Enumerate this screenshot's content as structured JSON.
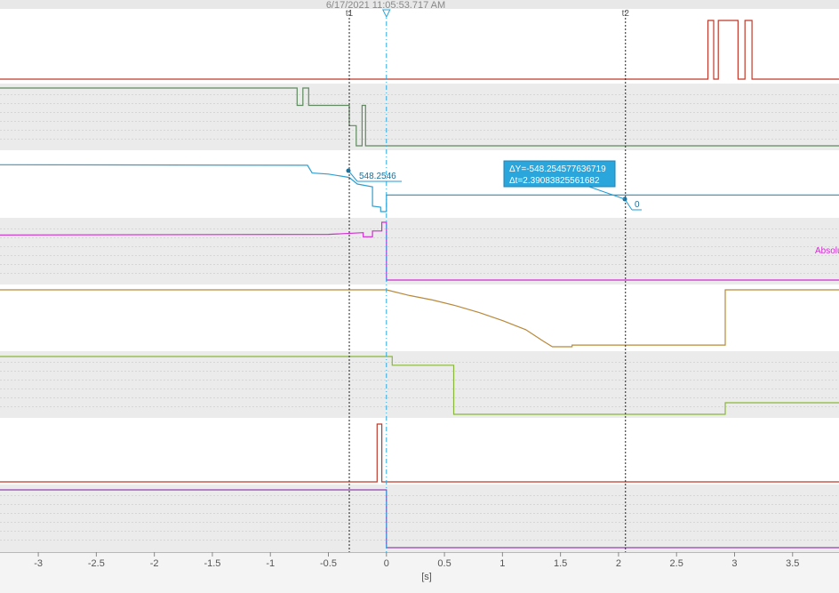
{
  "header": {
    "timestamp": "6/17/2021  11:05:53.717 AM"
  },
  "cursors": [
    {
      "label": "t1",
      "time": -0.32,
      "style": "black-dashed"
    },
    {
      "label": "",
      "time": 0.0,
      "style": "cyan-dashdot",
      "marker": "triangle-down"
    },
    {
      "label": "t2",
      "time": 2.06,
      "style": "black-dashed"
    }
  ],
  "measurement": {
    "delta_y_label": "ΔY=-548.254577636719",
    "delta_t_label": "Δt=2.39083825561682",
    "value_t1_label": "548.2546",
    "value_t2_label": "0",
    "accent": "#1e9bd7"
  },
  "signal_label": {
    "text": "Absolu",
    "color": "#d22bd2"
  },
  "x_axis": {
    "unit_label": "[s]",
    "range": [
      -3.33,
      3.9
    ],
    "ticks": [
      "-3",
      "-2.5",
      "-2",
      "-1.5",
      "-1",
      "-0.5",
      "0",
      "0.5",
      "1",
      "1.5",
      "2",
      "2.5",
      "3",
      "3.5"
    ]
  },
  "chart_data": {
    "type": "line",
    "title": "",
    "xlabel": "[s]",
    "xlim": [
      -3.33,
      3.9
    ],
    "series": [
      {
        "color": "#c0392b",
        "points": [
          [
            -3.33,
            0
          ],
          [
            2.77,
            0
          ],
          [
            2.77,
            1
          ],
          [
            2.82,
            1
          ],
          [
            2.82,
            0
          ],
          [
            2.86,
            0
          ],
          [
            2.86,
            1
          ],
          [
            3.03,
            1
          ],
          [
            3.03,
            0
          ],
          [
            3.09,
            0
          ],
          [
            3.09,
            1
          ],
          [
            3.15,
            1
          ],
          [
            3.15,
            0
          ],
          [
            3.9,
            0
          ]
        ]
      },
      {
        "color": "#5f8a5f",
        "points": [
          [
            -3.33,
            1
          ],
          [
            -0.77,
            1
          ],
          [
            -0.77,
            0.7
          ],
          [
            -0.72,
            0.7
          ],
          [
            -0.72,
            1
          ],
          [
            -0.67,
            1
          ],
          [
            -0.67,
            0.7
          ],
          [
            -0.32,
            0.7
          ],
          [
            -0.32,
            0.35
          ],
          [
            -0.26,
            0.35
          ],
          [
            -0.26,
            0
          ],
          [
            -0.21,
            0
          ],
          [
            -0.21,
            0.7
          ],
          [
            -0.18,
            0.7
          ],
          [
            -0.18,
            0
          ],
          [
            3.9,
            0
          ]
        ]
      },
      {
        "color": "#2e9fd0",
        "points": [
          [
            -3.33,
            0.85
          ],
          [
            -0.68,
            0.84
          ],
          [
            -0.64,
            0.7
          ],
          [
            -0.5,
            0.68
          ],
          [
            -0.32,
            0.62
          ],
          [
            -0.25,
            0.5
          ],
          [
            -0.12,
            0.45
          ],
          [
            -0.12,
            0.1
          ],
          [
            -0.05,
            0.08
          ],
          [
            -0.05,
            0
          ],
          [
            0,
            0
          ],
          [
            0,
            0.3
          ],
          [
            3.9,
            0.3
          ]
        ]
      },
      {
        "color": "#d22bd2",
        "points": [
          [
            -3.33,
            0.78
          ],
          [
            -0.5,
            0.79
          ],
          [
            -0.2,
            0.82
          ],
          [
            -0.2,
            0.75
          ],
          [
            -0.12,
            0.75
          ],
          [
            -0.12,
            0.85
          ],
          [
            -0.04,
            0.85
          ],
          [
            -0.04,
            1
          ],
          [
            0,
            1
          ],
          [
            0,
            0
          ],
          [
            3.9,
            0
          ]
        ]
      },
      {
        "color": "#b8893a",
        "points": [
          [
            -3.33,
            1
          ],
          [
            0,
            1
          ],
          [
            0.2,
            0.9
          ],
          [
            0.4,
            0.82
          ],
          [
            0.6,
            0.72
          ],
          [
            0.8,
            0.6
          ],
          [
            1.0,
            0.46
          ],
          [
            1.2,
            0.3
          ],
          [
            1.35,
            0.1
          ],
          [
            1.43,
            0
          ],
          [
            1.6,
            0
          ],
          [
            1.6,
            0.03
          ],
          [
            2.92,
            0.03
          ],
          [
            2.92,
            1
          ],
          [
            3.9,
            1
          ]
        ]
      },
      {
        "color": "#8ab83a",
        "points": [
          [
            -3.33,
            1
          ],
          [
            0.05,
            1
          ],
          [
            0.05,
            0.85
          ],
          [
            0.58,
            0.85
          ],
          [
            0.58,
            0
          ],
          [
            2.92,
            0
          ],
          [
            2.92,
            0.2
          ],
          [
            3.9,
            0.2
          ]
        ]
      },
      {
        "color": "#c0392b",
        "points": [
          [
            -3.33,
            0
          ],
          [
            -0.08,
            0
          ],
          [
            -0.08,
            1
          ],
          [
            -0.04,
            1
          ],
          [
            -0.04,
            0
          ],
          [
            3.9,
            0
          ]
        ]
      },
      {
        "color": "#8e44ad",
        "points": [
          [
            -3.33,
            1
          ],
          [
            0,
            1
          ],
          [
            0,
            0
          ],
          [
            3.9,
            0
          ]
        ]
      }
    ]
  }
}
